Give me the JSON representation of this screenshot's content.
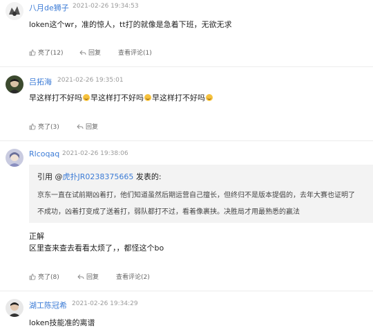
{
  "comments": [
    {
      "username": "八月de狮子",
      "time": "2021-02-26 19:34:53",
      "text": "loken这个wr，准的惊人，tt打的就像是急着下班，无欲无求",
      "like_label": "亮了(12)",
      "reply_label": "回复",
      "view_label": "查看评论(1)"
    },
    {
      "username": "吕拓海",
      "time": "2021-02-26 19:35:01",
      "text_segment": "早这样打不好吗",
      "emoji": "sweat-smile-emoji",
      "like_label": "亮了(3)",
      "reply_label": "回复"
    },
    {
      "username": "Rlcoqaq",
      "time": "2021-02-26 19:38:06",
      "quote": {
        "prefix": "引用 @",
        "author": "虎扑JR0238375665",
        "suffix": " 发表的:",
        "line1": "京东一直在试前期凶着打，他们知道虽然后期运营自己擅长，但终归不是版本提倡的，去年大赛也证明了",
        "line2": "不成功，凶着打变成了送着打，弱队都打不过，看着像裹挟。决胜局才用最熟悉的赢法"
      },
      "reply_line1": "正解",
      "reply_line2": "区里查来查去看看太烦了，，都怪这个bo",
      "like_label": "亮了(8)",
      "reply_label": "回复",
      "view_label": "查看评论(2)"
    },
    {
      "username": "湖工陈冠希",
      "time": "2021-02-26 19:34:29",
      "text": "loken技能准的离谱"
    }
  ],
  "icons": {
    "like": "thumbs-up-icon",
    "reply": "reply-arrow-icon"
  },
  "colors": {
    "username": "#3b7bd6",
    "link": "#3b7bd6",
    "quote_bg": "#f3f3f3"
  }
}
